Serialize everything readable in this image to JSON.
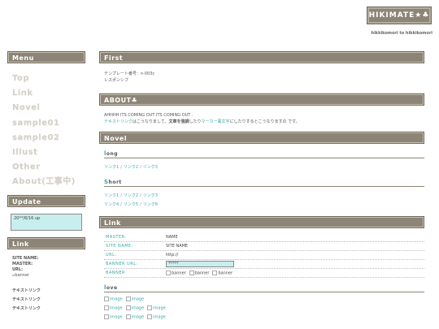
{
  "header": {
    "logo": "HIKIMATE★♣",
    "subtitle": "hikkikomori to hikkikomori"
  },
  "sidebar": {
    "menu_title": "Menu",
    "menu_items": [
      "Top",
      "Link",
      "Novel",
      "sample01",
      "sample02",
      "Illust",
      "Other",
      "About(工事中)"
    ],
    "update_title": "Update",
    "update_text": "20**/8/16 up",
    "link_title": "Link",
    "site_name_label": "SITE NAME:",
    "master_label": "MASTER:",
    "url_label": "URL:",
    "banner_alt": "banner",
    "text_links": [
      "テキストリンク",
      "テキストリンク",
      "テキストリンク"
    ]
  },
  "first": {
    "title": "First",
    "line1": "テンプレート番号：n-003c",
    "line2": "レスポンシブ"
  },
  "about": {
    "title": "ABOUT♣",
    "line1": "AHHHH ITS COMING OUT ITS COMING OUT .",
    "l2_a": "テキストリンク",
    "l2_b": "はこうなりまして、",
    "l2_c": "文章を強調",
    "l2_d": "したり",
    "l2_e": "マーカー風文字",
    "l2_f": "にしたりするとこうなりますの です。"
  },
  "novel": {
    "title": "Novel",
    "long_first": "l",
    "long_rest": "ong",
    "long_links": [
      "リンク1",
      "リンク2",
      "リンク3"
    ],
    "short_first": "S",
    "short_rest": "hort",
    "short_links_1": [
      "リンク1",
      "リンク2",
      "リンク3"
    ],
    "short_links_2": [
      "リンク4",
      "リンク5",
      "リンク6"
    ],
    "sep": "/"
  },
  "link": {
    "title": "Link",
    "rows": {
      "master_label": "MASTER:",
      "master_value": "NAME",
      "site_label": "SITE NAME:",
      "site_value": "SITE NAME",
      "url_label": "URL:",
      "url_value": "http://",
      "banner_url_label": "BANNER URL:",
      "banner_url_value": "*****",
      "banner_label": "BANNER",
      "banner_value": "banner"
    },
    "love_first": "l",
    "love_rest": "ove",
    "image_alt": "image"
  }
}
